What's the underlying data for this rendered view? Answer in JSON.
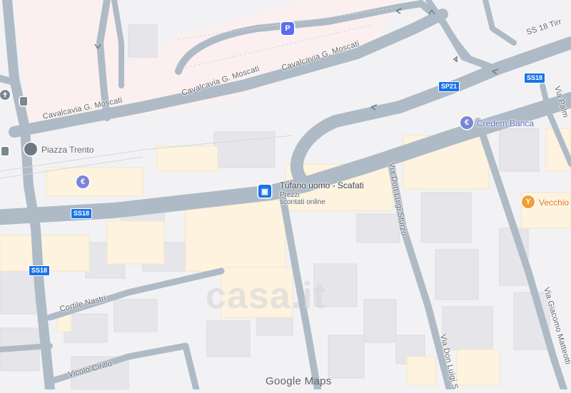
{
  "map": {
    "streets": {
      "cavalcavia_1": "Cavalcavia G. Moscati",
      "cavalcavia_2": "Cavalcavia G. Moscati",
      "cavalcavia_3": "Cavalcavia G. Moscati",
      "ss18_tirreno": "SS 18 Tirr",
      "via_don_luigi_sturzo": "Via Don Luigi Sturzo",
      "via_don_luigi_s": "Via Don Luigi S",
      "via_giacomo_matteotti": "Via Giacomo Matteotti",
      "via_palm": "Via Palm",
      "cortile_nastri": "Cortile Nastri",
      "vicolo_cirillo": "Vicolo Cirillo"
    },
    "road_shields": {
      "ss18_a": "SS18",
      "ss18_b": "SS18",
      "ss18_c": "SS18",
      "sp21": "SP21"
    },
    "places": {
      "piazza_trento": "Piazza Trento",
      "credem": "Credem Banca",
      "tufano_title": "Tufano uomo - Scafati",
      "tufano_sub1": "Prezzi",
      "tufano_sub2": "scontati online",
      "vecchio": "Vecchio"
    },
    "icons": {
      "parking": "P",
      "bank": "€",
      "church": "✝"
    },
    "attribution": "Google Maps",
    "watermark": "casa.it"
  },
  "colors": {
    "road": "#aebbc6",
    "background": "#f2f2f4",
    "building": "#e6e6ea",
    "commercial": "#fdf3df",
    "shield": "#1a73e8"
  }
}
